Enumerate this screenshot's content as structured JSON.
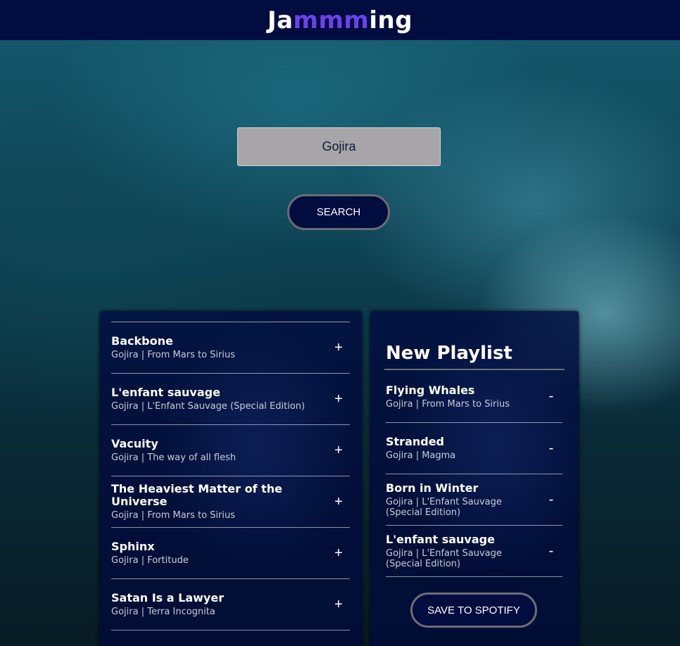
{
  "header": {
    "logo_start": "Ja",
    "logo_accent": "mmm",
    "logo_end": "ing",
    "background_color": "#010c3f",
    "accent_color": "#6c41ec"
  },
  "search": {
    "value": "Gojira",
    "button_label": "SEARCH"
  },
  "results": {
    "action_symbol": "+",
    "tracks": [
      {
        "name": "Backbone",
        "meta": "Gojira | From Mars to Sirius"
      },
      {
        "name": "L'enfant sauvage",
        "meta": "Gojira | L'Enfant Sauvage (Special Edition)"
      },
      {
        "name": "Vacuity",
        "meta": "Gojira | The way of all flesh"
      },
      {
        "name": "The Heaviest Matter of the Universe",
        "meta": "Gojira | From Mars to Sirius"
      },
      {
        "name": "Sphinx",
        "meta": "Gojira | Fortitude"
      },
      {
        "name": "Satan Is a Lawyer",
        "meta": "Gojira | Terra Incognita"
      }
    ]
  },
  "playlist": {
    "title": "New Playlist",
    "action_symbol": "-",
    "tracks": [
      {
        "name": "Flying Whales",
        "meta": "Gojira | From Mars to Sirius"
      },
      {
        "name": "Stranded",
        "meta": "Gojira | Magma"
      },
      {
        "name": "Born in Winter",
        "meta": "Gojira | L'Enfant Sauvage (Special Edition)"
      },
      {
        "name": "L'enfant sauvage",
        "meta": "Gojira | L'Enfant Sauvage (Special Edition)"
      }
    ],
    "save_label": "SAVE TO SPOTIFY"
  }
}
